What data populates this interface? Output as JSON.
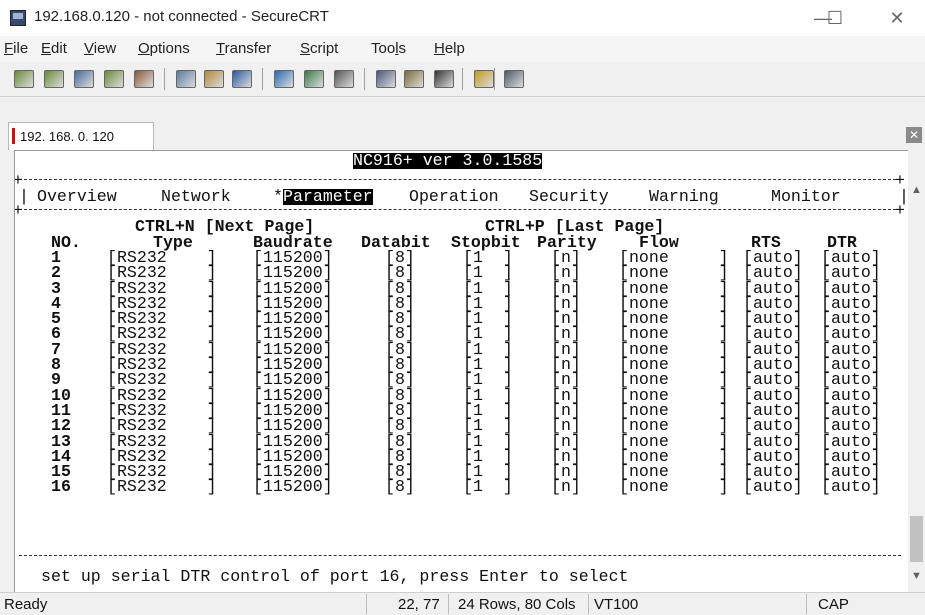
{
  "window": {
    "title": "192.168.0.120 - not connected - SecureCRT",
    "min": "—",
    "max": "☐",
    "close": "✕"
  },
  "menu": [
    "File",
    "Edit",
    "View",
    "Options",
    "Transfer",
    "Script",
    "Tools",
    "Help"
  ],
  "menu_underline": [
    "F",
    "E",
    "V",
    "O",
    "T",
    "S",
    "l",
    "H"
  ],
  "toolbar": {
    "icons": [
      "connect-icon",
      "quick-connect-icon",
      "connect-tab-icon",
      "reconnect-icon",
      "disconnect-icon",
      "copy-icon",
      "paste-icon",
      "find-icon",
      "print-setup-icon",
      "log-session-icon",
      "print-icon",
      "session-options-icon",
      "keymap-icon",
      "sftp-icon",
      "help-icon",
      "terminal-icon"
    ]
  },
  "tab": {
    "label": "192. 168. 0. 120",
    "close": "✕"
  },
  "terminal": {
    "header": "NC916+ ver 3.0.1585",
    "nav": [
      "Overview",
      "Network",
      "*",
      "Parameter",
      "Operation",
      "Security",
      "Warning",
      "Monitor"
    ],
    "next_page": "CTRL+N [Next Page]",
    "last_page": "CTRL+P [Last Page]",
    "columns": [
      "NO.",
      "Type",
      "Baudrate",
      "Databit",
      "Stopbit",
      "Parity",
      "Flow",
      "RTS",
      "DTR"
    ],
    "rows": [
      {
        "no": "1",
        "type": "[RS232    ]",
        "baud": "[115200]",
        "data": "[8]",
        "stop": "[1  ]",
        "parity": "[n]",
        "flow": "[none     ]",
        "rts": "[auto]",
        "dtr": "[auto]"
      },
      {
        "no": "2",
        "type": "[RS232    ]",
        "baud": "[115200]",
        "data": "[8]",
        "stop": "[1  ]",
        "parity": "[n]",
        "flow": "[none     ]",
        "rts": "[auto]",
        "dtr": "[auto]"
      },
      {
        "no": "3",
        "type": "[RS232    ]",
        "baud": "[115200]",
        "data": "[8]",
        "stop": "[1  ]",
        "parity": "[n]",
        "flow": "[none     ]",
        "rts": "[auto]",
        "dtr": "[auto]"
      },
      {
        "no": "4",
        "type": "[RS232    ]",
        "baud": "[115200]",
        "data": "[8]",
        "stop": "[1  ]",
        "parity": "[n]",
        "flow": "[none     ]",
        "rts": "[auto]",
        "dtr": "[auto]"
      },
      {
        "no": "5",
        "type": "[RS232    ]",
        "baud": "[115200]",
        "data": "[8]",
        "stop": "[1  ]",
        "parity": "[n]",
        "flow": "[none     ]",
        "rts": "[auto]",
        "dtr": "[auto]"
      },
      {
        "no": "6",
        "type": "[RS232    ]",
        "baud": "[115200]",
        "data": "[8]",
        "stop": "[1  ]",
        "parity": "[n]",
        "flow": "[none     ]",
        "rts": "[auto]",
        "dtr": "[auto]"
      },
      {
        "no": "7",
        "type": "[RS232    ]",
        "baud": "[115200]",
        "data": "[8]",
        "stop": "[1  ]",
        "parity": "[n]",
        "flow": "[none     ]",
        "rts": "[auto]",
        "dtr": "[auto]"
      },
      {
        "no": "8",
        "type": "[RS232    ]",
        "baud": "[115200]",
        "data": "[8]",
        "stop": "[1  ]",
        "parity": "[n]",
        "flow": "[none     ]",
        "rts": "[auto]",
        "dtr": "[auto]"
      },
      {
        "no": "9",
        "type": "[RS232    ]",
        "baud": "[115200]",
        "data": "[8]",
        "stop": "[1  ]",
        "parity": "[n]",
        "flow": "[none     ]",
        "rts": "[auto]",
        "dtr": "[auto]"
      },
      {
        "no": "10",
        "type": "[RS232    ]",
        "baud": "[115200]",
        "data": "[8]",
        "stop": "[1  ]",
        "parity": "[n]",
        "flow": "[none     ]",
        "rts": "[auto]",
        "dtr": "[auto]"
      },
      {
        "no": "11",
        "type": "[RS232    ]",
        "baud": "[115200]",
        "data": "[8]",
        "stop": "[1  ]",
        "parity": "[n]",
        "flow": "[none     ]",
        "rts": "[auto]",
        "dtr": "[auto]"
      },
      {
        "no": "12",
        "type": "[RS232    ]",
        "baud": "[115200]",
        "data": "[8]",
        "stop": "[1  ]",
        "parity": "[n]",
        "flow": "[none     ]",
        "rts": "[auto]",
        "dtr": "[auto]"
      },
      {
        "no": "13",
        "type": "[RS232    ]",
        "baud": "[115200]",
        "data": "[8]",
        "stop": "[1  ]",
        "parity": "[n]",
        "flow": "[none     ]",
        "rts": "[auto]",
        "dtr": "[auto]"
      },
      {
        "no": "14",
        "type": "[RS232    ]",
        "baud": "[115200]",
        "data": "[8]",
        "stop": "[1  ]",
        "parity": "[n]",
        "flow": "[none     ]",
        "rts": "[auto]",
        "dtr": "[auto]"
      },
      {
        "no": "15",
        "type": "[RS232    ]",
        "baud": "[115200]",
        "data": "[8]",
        "stop": "[1  ]",
        "parity": "[n]",
        "flow": "[none     ]",
        "rts": "[auto]",
        "dtr": "[auto]"
      },
      {
        "no": "16",
        "type": "[RS232    ]",
        "baud": "[115200]",
        "data": "[8]",
        "stop": "[1  ]",
        "parity": "[n]",
        "flow": "[none     ]",
        "rts": "[auto]",
        "dtr": "[auto]"
      }
    ],
    "help_line": "set up serial DTR control of port 16, press Enter to select"
  },
  "status": {
    "ready": "Ready",
    "cursor": "22, 77",
    "size": "24 Rows, 80 Cols",
    "emulation": "VT100",
    "caps": "CAP"
  }
}
